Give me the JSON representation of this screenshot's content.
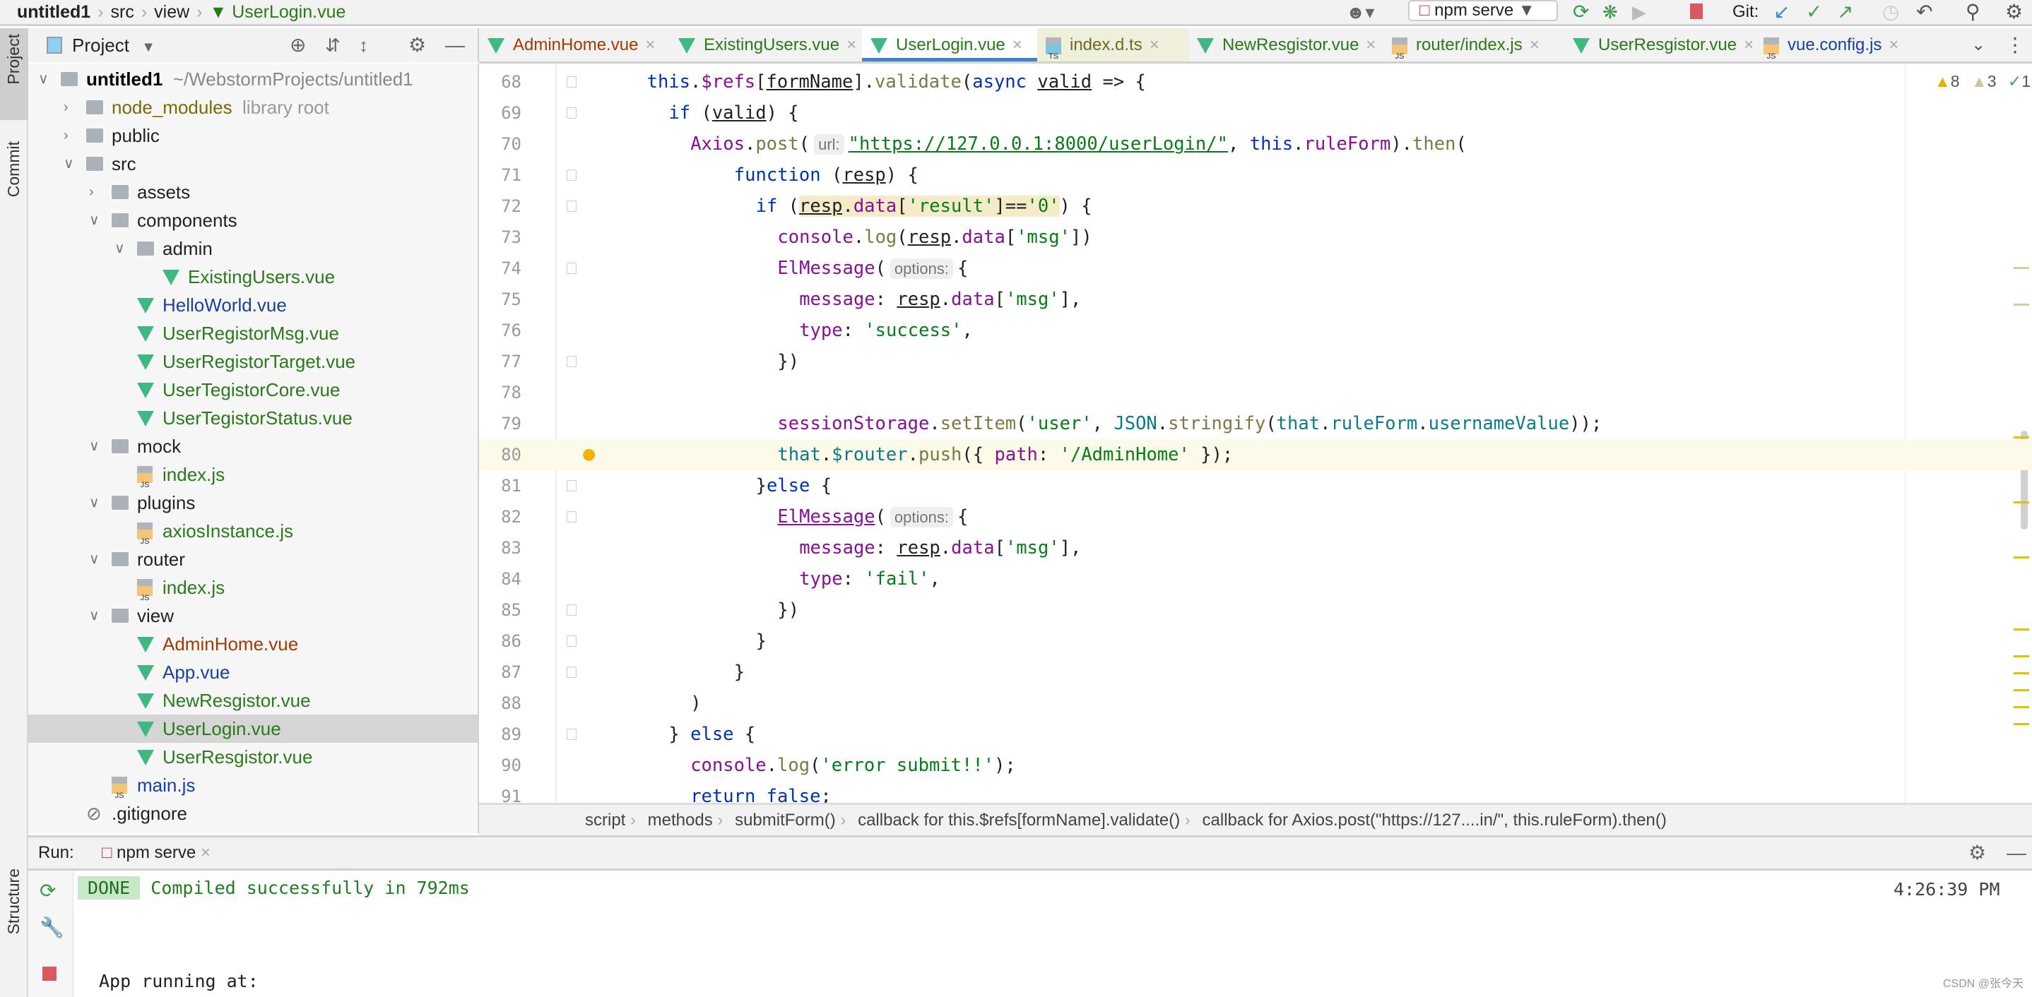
{
  "breadcrumb": [
    "untitled1",
    "src",
    "view",
    "UserLogin.vue"
  ],
  "toolbar": {
    "run_config": "npm serve",
    "git_label": "Git:"
  },
  "left_stripe": {
    "project": "Project",
    "commit": "Commit",
    "structure": "Structure"
  },
  "project_panel": {
    "title": "Project",
    "tree": [
      {
        "label": "untitled1",
        "extra": "~/WebstormProjects/untitled1",
        "level": 0,
        "type": "folder",
        "open": true,
        "bold": true,
        "color": "#000000"
      },
      {
        "label": "node_modules",
        "extra": "library root",
        "level": 1,
        "type": "folder",
        "open": false,
        "color": "#7a6a00"
      },
      {
        "label": "public",
        "level": 1,
        "type": "folder",
        "open": false,
        "color": "#222222"
      },
      {
        "label": "src",
        "level": 1,
        "type": "folder",
        "open": true,
        "color": "#222222"
      },
      {
        "label": "assets",
        "level": 2,
        "type": "folder",
        "open": false,
        "color": "#222222"
      },
      {
        "label": "components",
        "level": 2,
        "type": "folder",
        "open": true,
        "color": "#222222"
      },
      {
        "label": "admin",
        "level": 3,
        "type": "folder",
        "open": true,
        "color": "#222222"
      },
      {
        "label": "ExistingUsers.vue",
        "level": 4,
        "type": "vue",
        "color": "#2a7a1a"
      },
      {
        "label": "HelloWorld.vue",
        "level": 3,
        "type": "vue",
        "color": "#1a3ea8"
      },
      {
        "label": "UserRegistorMsg.vue",
        "level": 3,
        "type": "vue",
        "color": "#2a7a1a"
      },
      {
        "label": "UserRegistorTarget.vue",
        "level": 3,
        "type": "vue",
        "color": "#2a7a1a"
      },
      {
        "label": "UserTegistorCore.vue",
        "level": 3,
        "type": "vue",
        "color": "#2a7a1a"
      },
      {
        "label": "UserTegistorStatus.vue",
        "level": 3,
        "type": "vue",
        "color": "#2a7a1a"
      },
      {
        "label": "mock",
        "level": 2,
        "type": "folder",
        "open": true,
        "color": "#222222"
      },
      {
        "label": "index.js",
        "level": 3,
        "type": "js",
        "color": "#2a7a1a"
      },
      {
        "label": "plugins",
        "level": 2,
        "type": "folder",
        "open": true,
        "color": "#222222"
      },
      {
        "label": "axiosInstance.js",
        "level": 3,
        "type": "js",
        "color": "#2a7a1a"
      },
      {
        "label": "router",
        "level": 2,
        "type": "folder",
        "open": true,
        "color": "#222222"
      },
      {
        "label": "index.js",
        "level": 3,
        "type": "js",
        "color": "#2a7a1a"
      },
      {
        "label": "view",
        "level": 2,
        "type": "folder",
        "open": true,
        "color": "#222222"
      },
      {
        "label": "AdminHome.vue",
        "level": 3,
        "type": "vue",
        "color": "#a33a00"
      },
      {
        "label": "App.vue",
        "level": 3,
        "type": "vue",
        "color": "#1a3ea8"
      },
      {
        "label": "NewResgistor.vue",
        "level": 3,
        "type": "vue",
        "color": "#2a7a1a"
      },
      {
        "label": "UserLogin.vue",
        "level": 3,
        "type": "vue",
        "color": "#2a7a1a",
        "selected": true
      },
      {
        "label": "UserResgistor.vue",
        "level": 3,
        "type": "vue",
        "color": "#2a7a1a"
      },
      {
        "label": "main.js",
        "level": 2,
        "type": "js",
        "color": "#1a3ea8"
      },
      {
        "label": ".gitignore",
        "level": 1,
        "type": "file",
        "color": "#222222"
      }
    ]
  },
  "tabs": [
    {
      "label": "AdminHome.vue",
      "type": "vue",
      "color": "#a33a00"
    },
    {
      "label": "ExistingUsers.vue",
      "type": "vue",
      "color": "#2a7a1a"
    },
    {
      "label": "UserLogin.vue",
      "type": "vue",
      "color": "#2a7a1a",
      "active": true
    },
    {
      "label": "index.d.ts",
      "type": "ts",
      "color": "#6f6a2a",
      "highlight": true
    },
    {
      "label": "NewResgistor.vue",
      "type": "vue",
      "color": "#2a7a1a"
    },
    {
      "label": "router/index.js",
      "type": "js",
      "color": "#2a7a1a"
    },
    {
      "label": "UserResgistor.vue",
      "type": "vue",
      "color": "#2a7a1a"
    },
    {
      "label": "vue.config.js",
      "type": "js",
      "color": "#1a3ea8"
    }
  ],
  "inspections": {
    "warnings": "8",
    "weak_warnings": "3",
    "typos": "1"
  },
  "code_lines": [
    {
      "n": "68",
      "indent": 4,
      "t": [
        [
          "k",
          "this"
        ],
        [
          "",
          "."
        ],
        [
          "p",
          "$refs"
        ],
        [
          "",
          "["
        ],
        [
          "u",
          "formName"
        ],
        [
          "",
          "]."
        ],
        [
          "m",
          "validate"
        ],
        [
          "",
          "("
        ],
        [
          "k",
          "async "
        ],
        [
          "u",
          "valid"
        ],
        [
          "",
          " => {"
        ]
      ]
    },
    {
      "n": "69",
      "indent": 6,
      "t": [
        [
          "k",
          "if"
        ],
        [
          "",
          " ("
        ],
        [
          "u",
          "valid"
        ],
        [
          "",
          ") {"
        ]
      ]
    },
    {
      "n": "70",
      "indent": 8,
      "t": [
        [
          "p",
          "Axios"
        ],
        [
          "",
          "."
        ],
        [
          "m",
          "post"
        ],
        [
          "",
          "("
        ],
        [
          "hint",
          "url:"
        ],
        [
          "s u",
          "\"https://127.0.0.1:8000/userLogin/\""
        ],
        [
          "",
          ", "
        ],
        [
          "k",
          "this"
        ],
        [
          "",
          "."
        ],
        [
          "p",
          "ruleForm"
        ],
        [
          "",
          ")."
        ],
        [
          "m",
          "then"
        ],
        [
          "",
          "("
        ]
      ]
    },
    {
      "n": "71",
      "indent": 12,
      "t": [
        [
          "k",
          "function"
        ],
        [
          "",
          " ("
        ],
        [
          "u",
          "resp"
        ],
        [
          "",
          ") {"
        ]
      ]
    },
    {
      "n": "72",
      "indent": 14,
      "t": [
        [
          "k",
          "if"
        ],
        [
          "",
          " ("
        ],
        [
          "u hlbg",
          "resp"
        ],
        [
          "hlbg",
          "."
        ],
        [
          "p hlbg",
          "data"
        ],
        [
          "hlbg",
          "["
        ],
        [
          "s hlbg",
          "'result'"
        ],
        [
          "hlbg",
          "]=="
        ],
        [
          "s hlbg",
          "'0'"
        ],
        [
          "",
          ") {"
        ]
      ]
    },
    {
      "n": "73",
      "indent": 16,
      "t": [
        [
          "p",
          "console"
        ],
        [
          "",
          "."
        ],
        [
          "m",
          "log"
        ],
        [
          "",
          "("
        ],
        [
          "u",
          "resp"
        ],
        [
          "",
          "."
        ],
        [
          "p",
          "data"
        ],
        [
          "",
          "["
        ],
        [
          "s",
          "'msg'"
        ],
        [
          "",
          "])"
        ]
      ]
    },
    {
      "n": "74",
      "indent": 16,
      "t": [
        [
          "p",
          "ElMessage"
        ],
        [
          "",
          "("
        ],
        [
          "hint",
          "options:"
        ],
        [
          "",
          "{"
        ]
      ]
    },
    {
      "n": "75",
      "indent": 18,
      "t": [
        [
          "p",
          "message"
        ],
        [
          "",
          ": "
        ],
        [
          "u",
          "resp"
        ],
        [
          "",
          "."
        ],
        [
          "p",
          "data"
        ],
        [
          "",
          "["
        ],
        [
          "s",
          "'msg'"
        ],
        [
          "",
          "],"
        ]
      ]
    },
    {
      "n": "76",
      "indent": 18,
      "t": [
        [
          "p",
          "type"
        ],
        [
          "",
          ": "
        ],
        [
          "s",
          "'success'"
        ],
        [
          "",
          ","
        ]
      ]
    },
    {
      "n": "77",
      "indent": 16,
      "t": [
        [
          "",
          "})"
        ]
      ]
    },
    {
      "n": "78",
      "indent": 0,
      "t": []
    },
    {
      "n": "79",
      "indent": 16,
      "t": [
        [
          "p",
          "sessionStorage"
        ],
        [
          "",
          "."
        ],
        [
          "m",
          "setItem"
        ],
        [
          "",
          "("
        ],
        [
          "s",
          "'user'"
        ],
        [
          "",
          ", "
        ],
        [
          "tl",
          "JSON"
        ],
        [
          "",
          "."
        ],
        [
          "m",
          "stringify"
        ],
        [
          "",
          "("
        ],
        [
          "tl",
          "that"
        ],
        [
          "",
          "."
        ],
        [
          "tl",
          "ruleForm"
        ],
        [
          "",
          "."
        ],
        [
          "tl",
          "usernameValue"
        ],
        [
          "",
          "));"
        ]
      ]
    },
    {
      "n": "80",
      "indent": 16,
      "current": true,
      "t": [
        [
          "tl",
          "that"
        ],
        [
          "",
          "."
        ],
        [
          "tl",
          "$router"
        ],
        [
          "",
          "."
        ],
        [
          "m",
          "push"
        ],
        [
          "",
          "({ "
        ],
        [
          "p",
          "path"
        ],
        [
          "",
          ": "
        ],
        [
          "s",
          "'/AdminHome'"
        ],
        [
          "",
          " });"
        ]
      ]
    },
    {
      "n": "81",
      "indent": 14,
      "t": [
        [
          "",
          "}"
        ],
        [
          "k",
          "else"
        ],
        [
          "",
          " {"
        ]
      ]
    },
    {
      "n": "82",
      "indent": 16,
      "t": [
        [
          "p u",
          "ElMessage"
        ],
        [
          "",
          "("
        ],
        [
          "hint",
          "options:"
        ],
        [
          "",
          "{"
        ]
      ]
    },
    {
      "n": "83",
      "indent": 18,
      "t": [
        [
          "p",
          "message"
        ],
        [
          "",
          ": "
        ],
        [
          "u",
          "resp"
        ],
        [
          "",
          "."
        ],
        [
          "p",
          "data"
        ],
        [
          "",
          "["
        ],
        [
          "s",
          "'msg'"
        ],
        [
          "",
          "],"
        ]
      ]
    },
    {
      "n": "84",
      "indent": 18,
      "t": [
        [
          "p",
          "type"
        ],
        [
          "",
          ": "
        ],
        [
          "s",
          "'fail'"
        ],
        [
          "",
          ","
        ]
      ]
    },
    {
      "n": "85",
      "indent": 16,
      "t": [
        [
          "",
          "})"
        ]
      ]
    },
    {
      "n": "86",
      "indent": 14,
      "t": [
        [
          "",
          "}"
        ]
      ]
    },
    {
      "n": "87",
      "indent": 12,
      "t": [
        [
          "",
          "}"
        ]
      ]
    },
    {
      "n": "88",
      "indent": 8,
      "t": [
        [
          "",
          ")"
        ]
      ]
    },
    {
      "n": "89",
      "indent": 6,
      "t": [
        [
          "",
          "} "
        ],
        [
          "k",
          "else"
        ],
        [
          "",
          " {"
        ]
      ]
    },
    {
      "n": "90",
      "indent": 8,
      "t": [
        [
          "p",
          "console"
        ],
        [
          "",
          "."
        ],
        [
          "m",
          "log"
        ],
        [
          "",
          "("
        ],
        [
          "s",
          "'error submit!!'"
        ],
        [
          "",
          ");"
        ]
      ]
    },
    {
      "n": "91",
      "indent": 8,
      "t": [
        [
          "k",
          "return false"
        ],
        [
          "",
          ";"
        ]
      ]
    }
  ],
  "code_breadcrumb": [
    "script",
    "methods",
    "submitForm()",
    "callback for this.$refs[formName].validate()",
    "callback for Axios.post(\"https://127....in/\", this.ruleForm).then()"
  ],
  "run": {
    "label": "Run:",
    "config": "npm serve",
    "done": "DONE",
    "message": "Compiled successfully in 792ms",
    "time": "4:26:39 PM",
    "app_running": "App running at:"
  },
  "watermark": "CSDN @张今天"
}
